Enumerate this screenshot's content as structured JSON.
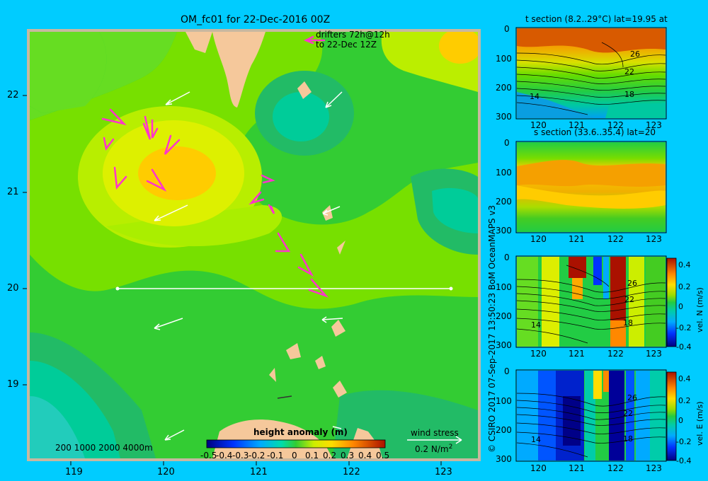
{
  "colors": {
    "background": "#00ccff",
    "land": "#f5c89b",
    "drifter": "#ff33cc",
    "wind": "#ffffff"
  },
  "main_panel": {
    "title": "OM_fc01 for 22-Dec-2016 00Z",
    "drifters_label_line1": "drifters 72h@12h",
    "drifters_label_line2": "to 22-Dec 12Z",
    "depth_contours": "200  1000  2000  4000m",
    "colorbar_title": "height anomaly  (m)",
    "colorbar_ticks": [
      "-0.5",
      "-0.4",
      "-0.3",
      "-0.2",
      "-0.1",
      "0",
      "0.1",
      "0.2",
      "0.3",
      "0.4",
      "0.5"
    ],
    "wind_stress_label": "wind stress",
    "wind_stress_scale": "0.2 N/m",
    "wind_stress_superscript": "2",
    "x_ticks": [
      "119",
      "120",
      "121",
      "122",
      "123"
    ],
    "y_ticks": [
      "22",
      "21",
      "20",
      "19"
    ],
    "credit": "© CSIRO 2017   07-Sep-2017 13:50:23 BoM OceanMAPS v3"
  },
  "chart_data": [
    {
      "type": "heatmap",
      "title": "OM_fc01 for 22-Dec-2016 00Z",
      "variable": "height anomaly (m)",
      "xlim": [
        118.5,
        123.5
      ],
      "ylim": [
        18.3,
        22.7
      ],
      "color_range": [
        -0.5,
        0.5
      ],
      "section_line": {
        "lat": 20,
        "lon": [
          119.5,
          123.2
        ]
      },
      "anomaly_features": [
        {
          "lon": 120.0,
          "lat": 21.2,
          "value": 0.3
        },
        {
          "lon": 121.8,
          "lat": 21.8,
          "value": -0.05
        },
        {
          "lon": 123.2,
          "lat": 22.5,
          "value": 0.25
        },
        {
          "lon": 119.0,
          "lat": 18.7,
          "value": -0.1
        },
        {
          "lon": 123.2,
          "lat": 20.8,
          "value": -0.05
        }
      ]
    },
    {
      "type": "heatmap",
      "title": "t section (8.2..29°C) lat=19.95 at",
      "variable": "temperature (°C)",
      "xticks": [
        "120",
        "121",
        "122",
        "123"
      ],
      "yticks": [
        "0",
        "100",
        "200",
        "300"
      ],
      "ylim": [
        300,
        0
      ],
      "color_range": [
        8.2,
        29
      ],
      "contour_labels": [
        "26",
        "22",
        "18",
        "14"
      ]
    },
    {
      "type": "heatmap",
      "title": "s section (33.6..35.4) lat=20",
      "variable": "salinity",
      "xticks": [
        "120",
        "121",
        "122",
        "123"
      ],
      "yticks": [
        "0",
        "100",
        "200",
        "300"
      ],
      "ylim": [
        300,
        0
      ],
      "color_range": [
        33.6,
        35.4
      ]
    },
    {
      "type": "heatmap",
      "title": "vel. N (m/s)",
      "variable": "vel. N (m/s)",
      "xticks": [
        "120",
        "121",
        "122",
        "123"
      ],
      "yticks": [
        "0",
        "100",
        "200",
        "300"
      ],
      "ylim": [
        300,
        0
      ],
      "color_range": [
        -0.4,
        0.4
      ],
      "colorbar_ticks": [
        "0.4",
        "0.2",
        "0",
        "-0.2",
        "-0.4"
      ],
      "contour_labels": [
        "26",
        "22",
        "14",
        "18"
      ]
    },
    {
      "type": "heatmap",
      "title": "vel. E (m/s)",
      "variable": "vel. E (m/s)",
      "xticks": [
        "120",
        "121",
        "122",
        "123"
      ],
      "yticks": [
        "0",
        "100",
        "200",
        "300"
      ],
      "ylim": [
        300,
        0
      ],
      "color_range": [
        -0.4,
        0.4
      ],
      "colorbar_ticks": [
        "0.4",
        "0.2",
        "0",
        "-0.2",
        "-0.4"
      ],
      "contour_labels": [
        "26",
        "22",
        "14",
        "18"
      ]
    }
  ],
  "sections": {
    "t_title": "t section (8.2..29°C) lat=19.95 at",
    "s_title": "s section (33.6..35.4) lat=20",
    "vn_label": "vel. N  (m/s)",
    "ve_label": "vel. E  (m/s)",
    "x_ticks": [
      "120",
      "121",
      "122",
      "123"
    ],
    "y_ticks": [
      "0",
      "100",
      "200",
      "300"
    ],
    "vel_cbar_ticks": [
      "0.4",
      "0.2",
      "0",
      "-0.2",
      "-0.4"
    ],
    "t_contours": [
      "26",
      "22",
      "18",
      "14"
    ],
    "v_contours": [
      "26",
      "22",
      "14",
      "18"
    ]
  }
}
